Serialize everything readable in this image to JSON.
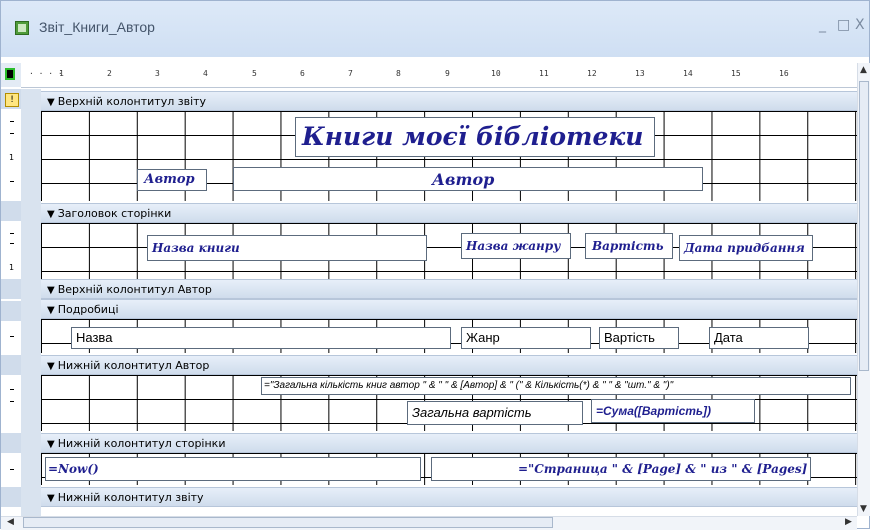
{
  "window": {
    "title": "Звіт_Книги_Автор",
    "minimize_glyph": "_",
    "maximize_glyph": "□",
    "close_glyph": "X"
  },
  "ruler": {
    "ticks": [
      "1",
      "2",
      "3",
      "4",
      "5",
      "6",
      "7",
      "8",
      "9",
      "10",
      "11",
      "12",
      "13",
      "14",
      "15",
      "16"
    ],
    "vertical_numbers": [
      "1",
      "1"
    ]
  },
  "sections": {
    "report_header": "Верхній колонтитул звіту",
    "page_header": "Заголовок сторінки",
    "group_header": "Верхній колонтитул Автор",
    "detail": "Подробиці",
    "group_footer": "Нижній колонтитул Автор",
    "page_footer": "Нижній колонтитул сторінки",
    "report_footer": "Нижній колонтитул звіту"
  },
  "report_header": {
    "title": "Книги моєї бібліотеки",
    "author_label": "Автор",
    "author_field": "Автор"
  },
  "page_header": {
    "book_name": "Назва книги",
    "genre": "Назва жанру",
    "price": "Вартість",
    "purchase_date": "Дата придбання"
  },
  "detail": {
    "name": "Назва",
    "genre": "Жанр",
    "price": "Вартість",
    "date": "Дата"
  },
  "group_footer": {
    "expression": "=\"Загальна кількість книг автор \" & \" \" & [Автор] & \" (\" & Кількість(*) & \" \" & \"шт.\" & \")\"",
    "total_label": "Загальна вартість",
    "total_expression": "=Сума([Вартість])"
  },
  "page_footer": {
    "now_expression": "=Now()",
    "page_expression": "=\"Страница \" & [Page] & \" из \" & [Pages]"
  },
  "colors": {
    "band_background": "#d6e3f2",
    "title_text": "#1f1f8f"
  }
}
